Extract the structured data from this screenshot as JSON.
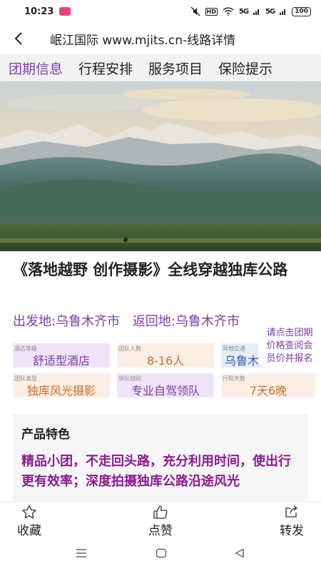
{
  "status_bar": {
    "time": "10:23",
    "hd_label": "HD",
    "signal1": "5G",
    "signal2": "5G",
    "battery": "100"
  },
  "header": {
    "title": "岷江国际  www.mjits.cn-线路详情",
    "back_icon": "chevron-left-icon"
  },
  "tabs": [
    {
      "label": "团期信息",
      "active": true
    },
    {
      "label": "行程安排",
      "active": false
    },
    {
      "label": "服务项目",
      "active": false
    },
    {
      "label": "保险提示",
      "active": false
    }
  ],
  "product": {
    "name": "《落地越野 创作摄影》全线穿越独库公路",
    "departure": "出发地:乌鲁木齐市",
    "return": "返回地:乌鲁木齐市"
  },
  "info_cells": [
    {
      "label": "酒店等级",
      "value": "舒适型酒店",
      "color": "#7a3fa6"
    },
    {
      "label": "团队人数",
      "value": "8-16人",
      "color": "#c9702e"
    },
    {
      "label": "异地交通",
      "value": "乌鲁木",
      "color": "#3b5ea8"
    },
    {
      "label": "团队类型",
      "value": "独库风光摄影",
      "color": "#c9702e"
    },
    {
      "label": "领队陪同",
      "value": "专业自驾领队",
      "color": "#7a3fa6"
    },
    {
      "label": "行程天数",
      "value": "7天6晚",
      "color": "#c9702e"
    }
  ],
  "signup_note": {
    "line1": "请点击团期",
    "line2": "价格查阅会",
    "line3": "员价并报名"
  },
  "features": {
    "heading": "产品特色",
    "text": "精品小团，不走回头路，充分利用时间，使出行更有效率；深度拍摄独库公路沿途风光"
  },
  "actions": [
    {
      "label": "收藏",
      "icon": "star-icon"
    },
    {
      "label": "点赞",
      "icon": "thumbs-up-icon"
    },
    {
      "label": "转发",
      "icon": "share-icon"
    }
  ],
  "colors": {
    "accent": "#7a3fa6",
    "feature_text": "#8a1c90",
    "orange": "#c9702e",
    "blue": "#3b5ea8"
  }
}
